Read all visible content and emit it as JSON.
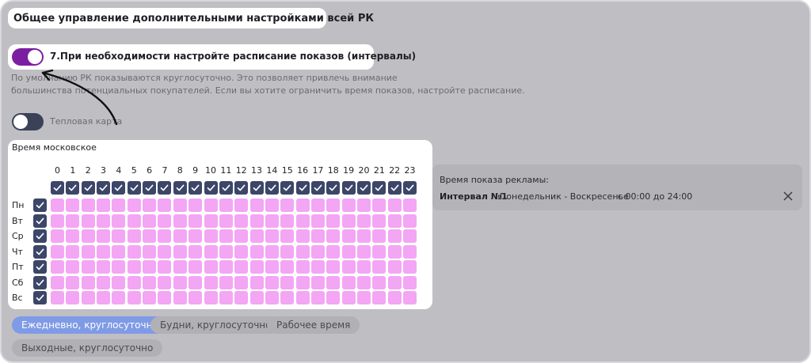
{
  "header": {
    "title": "Общее управление дополнительными настройками всей РК"
  },
  "schedule_toggle": {
    "label": "7.При необходимости настройте расписание показов (интервалы)",
    "state": "on"
  },
  "description": {
    "line1": "По умолчанию РК показываются круглосуточно. Это позволяет привлечь внимание",
    "line2": "большинства потенциальных покупателей. Если вы хотите ограничить время показов, настройте расписание."
  },
  "heatmap_toggle": {
    "label": "Тепловая карта",
    "state": "off"
  },
  "grid": {
    "timezone_label": "Время московское",
    "hours": [
      "0",
      "1",
      "2",
      "3",
      "4",
      "5",
      "6",
      "7",
      "8",
      "9",
      "10",
      "11",
      "12",
      "13",
      "14",
      "15",
      "16",
      "17",
      "18",
      "19",
      "20",
      "21",
      "22",
      "23"
    ],
    "days": [
      "Пн",
      "Вт",
      "Ср",
      "Чт",
      "Пт",
      "Сб",
      "Вс"
    ]
  },
  "summary": {
    "title": "Время показа рекламы:",
    "interval_name": "Интервал №1",
    "interval_days": "Понедельник - Воскресенье",
    "interval_time": "с 00:00 до 24:00"
  },
  "presets": [
    {
      "label": "Ежедневно, круглосуточно",
      "active": true
    },
    {
      "label": "Будни, круглосуточно",
      "active": false
    },
    {
      "label": "Рабочее время",
      "active": false
    },
    {
      "label": "Выходные, круглосуточно",
      "active": false
    }
  ],
  "colors": {
    "toggle_on": "#7b1fa2",
    "checkbox": "#3c4669",
    "cell_selected": "#f3a6f3",
    "preset_active": "#7f9ae6",
    "panel_background": "#bfbfc3"
  }
}
